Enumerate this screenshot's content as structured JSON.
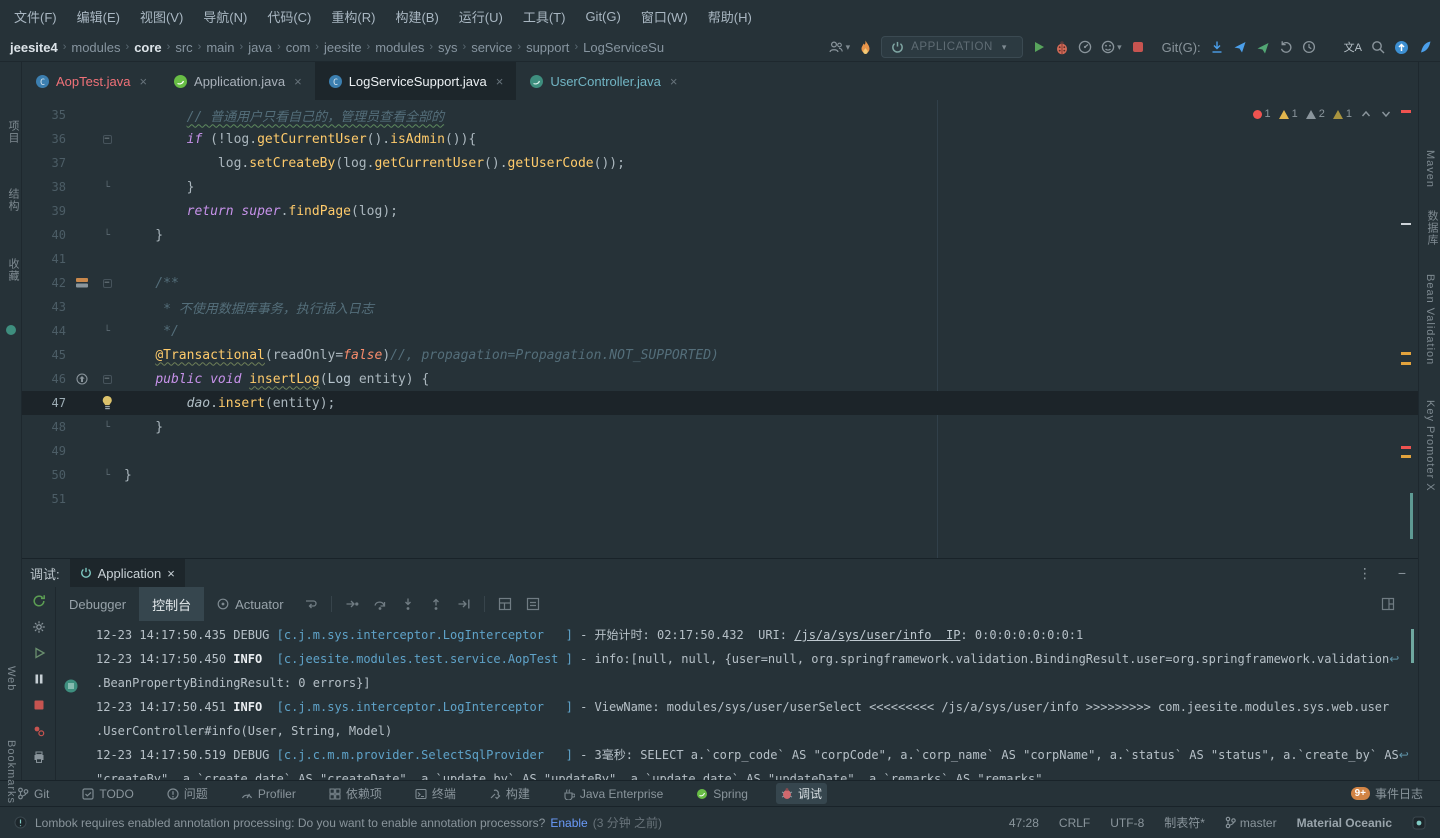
{
  "colors": {
    "bg": "#263238",
    "panel_dark": "#1D262B",
    "accent_teal": "#80CBC4",
    "run_green": "#58A45C",
    "stop_red": "#C75450",
    "error_red": "#EF5350",
    "warning_yellow": "#E2B64D",
    "link_blue": "#6B9BFA",
    "git_blue": "#4B9FEA"
  },
  "menu": {
    "items": [
      "文件(F)",
      "编辑(E)",
      "视图(V)",
      "导航(N)",
      "代码(C)",
      "重构(R)",
      "构建(B)",
      "运行(U)",
      "工具(T)",
      "Git(G)",
      "窗口(W)",
      "帮助(H)"
    ]
  },
  "navbar": {
    "breadcrumbs": [
      "jeesite4",
      "modules",
      "core",
      "src",
      "main",
      "java",
      "com",
      "jeesite",
      "modules",
      "sys",
      "service",
      "support",
      "LogServiceSu"
    ],
    "bold_crumbs": [
      "jeesite4",
      "core"
    ],
    "run_config": "APPLICATION",
    "git_label": "Git(G):",
    "translate_label": "文A"
  },
  "tabs": [
    {
      "label": "AopTest.java"
    },
    {
      "label": "Application.java"
    },
    {
      "label": "LogServiceSupport.java"
    },
    {
      "label": "UserController.java"
    }
  ],
  "inspections": {
    "errors": "1",
    "warnings": "1",
    "weak_warnings": "2",
    "typos": "1"
  },
  "editor": {
    "lines": [
      {
        "n": 35,
        "t": [
          [
            "pl",
            "        "
          ],
          [
            "cmw",
            "// 普通用户只看自己的，管理员查看全部的"
          ]
        ]
      },
      {
        "n": 36,
        "fold": "s",
        "t": [
          [
            "pl",
            "        "
          ],
          [
            "kw",
            "if"
          ],
          [
            "pl",
            " (!log."
          ],
          [
            "fn",
            "getCurrentUser"
          ],
          [
            "pl",
            "()."
          ],
          [
            "fn",
            "isAdmin"
          ],
          [
            "pl",
            "()){"
          ]
        ]
      },
      {
        "n": 37,
        "t": [
          [
            "pl",
            "            log."
          ],
          [
            "fn",
            "setCreateBy"
          ],
          [
            "pl",
            "(log."
          ],
          [
            "fn",
            "getCurrentUser"
          ],
          [
            "pl",
            "()."
          ],
          [
            "fn",
            "getUserCode"
          ],
          [
            "pl",
            "());"
          ]
        ]
      },
      {
        "n": 38,
        "fold": "e",
        "t": [
          [
            "pl",
            "        }"
          ]
        ]
      },
      {
        "n": 39,
        "t": [
          [
            "pl",
            "        "
          ],
          [
            "kw",
            "return"
          ],
          [
            "pl",
            " "
          ],
          [
            "kw",
            "super"
          ],
          [
            "pl",
            "."
          ],
          [
            "fn",
            "findPage"
          ],
          [
            "pl",
            "(log);"
          ]
        ]
      },
      {
        "n": 40,
        "fold": "e",
        "t": [
          [
            "pl",
            "    }"
          ]
        ]
      },
      {
        "n": 41,
        "t": []
      },
      {
        "n": 42,
        "fold": "s",
        "icon": "bookmark",
        "t": [
          [
            "cm",
            "    /**"
          ]
        ]
      },
      {
        "n": 43,
        "t": [
          [
            "cm",
            "     * 不使用数据库事务，执行插入日志"
          ]
        ]
      },
      {
        "n": 44,
        "fold": "e",
        "t": [
          [
            "cm",
            "     */"
          ]
        ]
      },
      {
        "n": 45,
        "t": [
          [
            "pl",
            "    "
          ],
          [
            "ann",
            "@Transactional"
          ],
          [
            "pl",
            "(readOnly="
          ],
          [
            "bool",
            "false"
          ],
          [
            "pl",
            ")"
          ],
          [
            "cm",
            "//, propagation=Propagation.NOT_SUPPORTED)"
          ]
        ]
      },
      {
        "n": 46,
        "fold": "s",
        "icon": "override",
        "t": [
          [
            "pl",
            "    "
          ],
          [
            "kw",
            "public"
          ],
          [
            "pl",
            " "
          ],
          [
            "kw",
            "void"
          ],
          [
            "pl",
            " "
          ],
          [
            "fnw",
            "insertLog"
          ],
          [
            "pl",
            "("
          ],
          [
            "cls",
            "Log"
          ],
          [
            "pl",
            " entity) {"
          ]
        ]
      },
      {
        "n": 47,
        "cur": true,
        "bulb": true,
        "t": [
          [
            "pl",
            "        "
          ],
          [
            "fld",
            "dao"
          ],
          [
            "pl",
            "."
          ],
          [
            "fn",
            "insert"
          ],
          [
            "pl",
            "(entity);"
          ]
        ]
      },
      {
        "n": 48,
        "fold": "e",
        "t": [
          [
            "pl",
            "    }"
          ]
        ]
      },
      {
        "n": 49,
        "t": []
      },
      {
        "n": 50,
        "fold": "e",
        "t": [
          [
            "pl",
            "}"
          ]
        ]
      },
      {
        "n": 51,
        "t": []
      }
    ]
  },
  "left_stripe": {
    "items": [
      "项目",
      "结构",
      "收藏",
      "Web",
      "Bookmarks"
    ]
  },
  "right_stripe": {
    "items": [
      "Maven",
      "数据库",
      "Bean Validation",
      "Key Promoter X"
    ]
  },
  "debug": {
    "label": "调试:",
    "session": "Application",
    "tabs": [
      "Debugger",
      "控制台",
      "Actuator"
    ],
    "console": [
      {
        "t": [
          [
            "t",
            "12-23 14:17:50.435 DEBUG "
          ],
          [
            "lg",
            "[c.j.m.sys.interceptor.LogInterceptor   ]"
          ],
          [
            "t",
            " - 开始计时: 02:17:50.432  URI: "
          ],
          [
            "lk",
            "/js/a/sys/user/info  IP"
          ],
          [
            "t",
            ": 0:0:0:0:0:0:0:1"
          ]
        ]
      },
      {
        "t": [
          [
            "t",
            "12-23 14:17:50.450 "
          ],
          [
            "inf",
            "INFO "
          ],
          [
            "t",
            " "
          ],
          [
            "lg",
            "[c.jeesite.modules.test.service.AopTest ]"
          ],
          [
            "t",
            " - info:[null, null, {user=null, org.springframework.validation.BindingResult.user=org.springframework.validation"
          ],
          [
            "wr",
            "↩"
          ]
        ]
      },
      {
        "t": [
          [
            "t",
            ".BeanPropertyBindingResult: 0 errors}]"
          ]
        ]
      },
      {
        "t": [
          [
            "t",
            "12-23 14:17:50.451 "
          ],
          [
            "inf",
            "INFO "
          ],
          [
            "t",
            " "
          ],
          [
            "lg",
            "[c.j.m.sys.interceptor.LogInterceptor   ]"
          ],
          [
            "t",
            " - ViewName: modules/sys/user/userSelect <<<<<<<<< /js/a/sys/user/info >>>>>>>>> com.jeesite.modules.sys.web.user"
          ]
        ]
      },
      {
        "t": [
          [
            "t",
            ".UserController#info(User, String, Model)"
          ]
        ]
      },
      {
        "t": [
          [
            "t",
            "12-23 14:17:50.519 DEBUG "
          ],
          [
            "lg",
            "[c.j.c.m.m.provider.SelectSqlProvider   ]"
          ],
          [
            "t",
            " - 3毫秒: SELECT a.`corp_code` AS \"corpCode\", a.`corp_name` AS \"corpName\", a.`status` AS \"status\", a.`create_by` AS"
          ],
          [
            "wr",
            "↩"
          ]
        ]
      },
      {
        "t": [
          [
            "t",
            "\"createBy\", a.`create_date` AS \"createDate\", a.`update_by` AS \"updateBy\", a.`update_date` AS \"updateDate\", a.`remarks` AS \"remarks\""
          ]
        ]
      }
    ]
  },
  "bottom_bar": {
    "items": [
      {
        "label": "Git"
      },
      {
        "label": "TODO"
      },
      {
        "label": "问题"
      },
      {
        "label": "Profiler"
      },
      {
        "label": "依赖项"
      },
      {
        "label": "终端"
      },
      {
        "label": "构建"
      },
      {
        "label": "Java Enterprise"
      },
      {
        "label": "Spring"
      },
      {
        "label": "调试"
      }
    ],
    "event_log": {
      "label": "事件日志",
      "badge": "9+"
    }
  },
  "status_bar": {
    "message": "Lombok requires enabled annotation processing: Do you want to enable annotation processors?",
    "action": "Enable",
    "time_ago": "(3 分钟 之前)",
    "caret": "47:28",
    "line_sep": "CRLF",
    "encoding": "UTF-8",
    "indent": "制表符*",
    "branch": "master",
    "theme": "Material Oceanic"
  }
}
